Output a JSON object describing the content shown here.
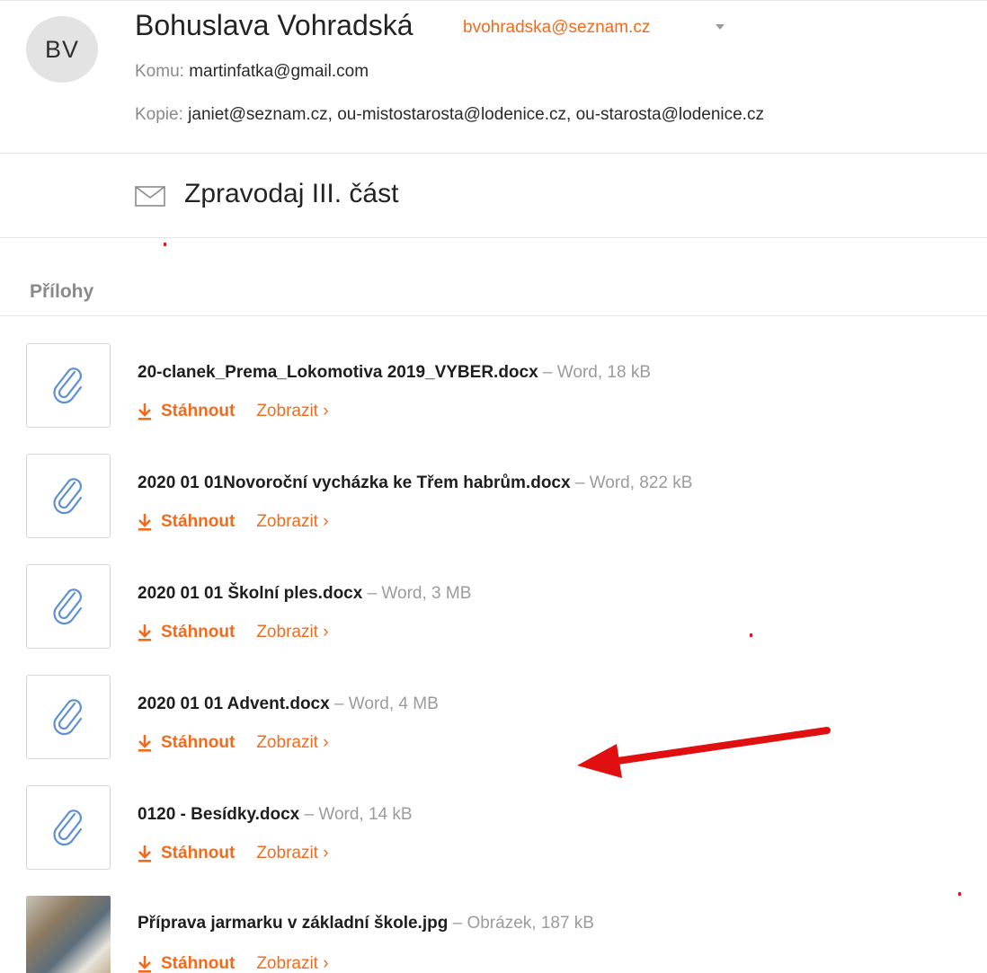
{
  "sender": {
    "initials": "BV",
    "name": "Bohuslava Vohradská",
    "email": "bvohradska@seznam.cz"
  },
  "to": {
    "label": "Komu:",
    "value": "martinfatka@gmail.com"
  },
  "cc": {
    "label": "Kopie:",
    "value": "janiet@seznam.cz, ou-mistostarosta@lodenice.cz, ou-starosta@lodenice.cz"
  },
  "subject": "Zpravodaj III. část",
  "attachments_heading": "Přílohy",
  "attachments": [
    {
      "name": "20-clanek_Prema_Lokomotiva 2019_VYBER.docx",
      "meta": " – Word, 18 kB",
      "download": "Stáhnout",
      "view": "Zobrazit ›",
      "icon": "paperclip-icon"
    },
    {
      "name": "2020 01 01Novoroční vycházka ke Třem habrům.docx",
      "meta": " – Word, 822 kB",
      "download": "Stáhnout",
      "view": "Zobrazit ›",
      "icon": "paperclip-icon"
    },
    {
      "name": "2020 01 01 Školní ples.docx",
      "meta": " – Word, 3 MB",
      "download": "Stáhnout",
      "view": "Zobrazit ›",
      "icon": "paperclip-icon"
    },
    {
      "name": "2020 01 01 Advent.docx",
      "meta": " – Word, 4 MB",
      "download": "Stáhnout",
      "view": "Zobrazit ›",
      "icon": "paperclip-icon"
    },
    {
      "name": "0120 - Besídky.docx",
      "meta": " – Word, 14 kB",
      "download": "Stáhnout",
      "view": "Zobrazit ›",
      "icon": "paperclip-icon"
    },
    {
      "name": "Příprava jarmarku v základní škole.jpg",
      "meta": " – Obrázek, 187 kB",
      "download": "Stáhnout",
      "view": "Zobrazit ›",
      "icon": "image-thumbnail"
    }
  ],
  "colors": {
    "accent": "#f26b1d",
    "annotation": "#e01010",
    "clip": "#5c8fd6"
  }
}
